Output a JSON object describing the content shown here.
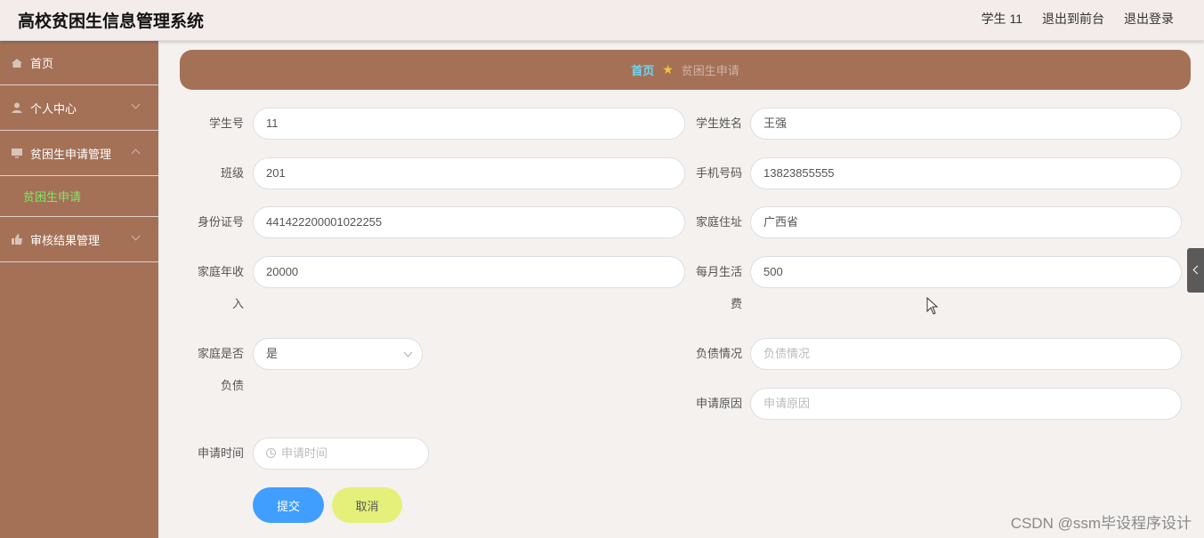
{
  "header": {
    "title": "高校贫困生信息管理系统",
    "user": "学生 11",
    "back_to_front": "退出到前台",
    "logout": "退出登录"
  },
  "sidebar": {
    "items": [
      {
        "label": "首页",
        "icon": "home-icon"
      },
      {
        "label": "个人中心",
        "icon": "user-icon"
      },
      {
        "label": "贫困生申请管理",
        "icon": "monitor-icon",
        "sub": "贫困生申请"
      },
      {
        "label": "审核结果管理",
        "icon": "thumb-icon"
      }
    ]
  },
  "breadcrumb": {
    "home": "首页",
    "current": "贫困生申请"
  },
  "form": {
    "student_no_label": "学生号",
    "student_no": "11",
    "student_name_label": "学生姓名",
    "student_name": "王强",
    "class_label": "班级",
    "class": "201",
    "phone_label": "手机号码",
    "phone": "13823855555",
    "id_label": "身份证号",
    "id": "441422200001022255",
    "address_label": "家庭住址",
    "address": "广西省",
    "income_label_1": "家庭年收",
    "income_label_2": "入",
    "income": "20000",
    "living_label_1": "每月生活",
    "living_label_2": "费",
    "living": "500",
    "debt_label_1": "家庭是否",
    "debt_label_2": "负债",
    "debt": "是",
    "debt_status_label": "负债情况",
    "debt_status_placeholder": "负债情况",
    "reason_label": "申请原因",
    "reason_placeholder": "申请原因",
    "time_label": "申请时间",
    "time_placeholder": "申请时间",
    "submit": "提交",
    "cancel": "取消"
  },
  "watermark": "CSDN @ssm毕设程序设计",
  "colors": {
    "sidebar": "#a47157",
    "active": "#7dea63",
    "primary": "#409eff",
    "cancel": "#e5f07a"
  }
}
